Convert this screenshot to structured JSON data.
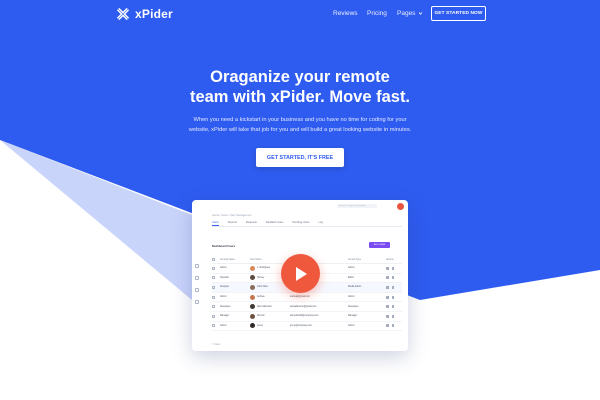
{
  "colors": {
    "primary_blue": "#2f5cf0",
    "light_blue": "#c9d4fb",
    "play_red": "#f0583e",
    "accent_purple": "#7a4cf2"
  },
  "nav": {
    "brand": "xPider",
    "links": [
      "Reviews",
      "Pricing",
      "Pages"
    ],
    "cta": "GET STARTED NOW"
  },
  "hero": {
    "headline_line1": "Oraganize your remote",
    "headline_line2": "team with xPider. Move fast.",
    "subtext_line1": "When you need a kickstart in your business and you have no time for coding for your",
    "subtext_line2": "website, xPider will take that job for you and will build a great looking website in minutes.",
    "cta": "GET STARTED, IT'S FREE"
  },
  "dashboard": {
    "breadcrumb": "Home / Users / User Management",
    "search_placeholder": "Search or type a command",
    "tabs": [
      "Users",
      "Reports",
      "Requests",
      "Disabled Users",
      "Pending Users",
      "Log"
    ],
    "section_title": "Dashboard Users",
    "add_button": "ADD USER",
    "columns": [
      "Account Name",
      "User Name",
      "Email Address",
      "Access Type",
      "Actions"
    ],
    "rows": [
      {
        "name": "Admin",
        "user": "L. Rodrigues",
        "email": "lrodrigues@gmail.com",
        "role": "Admin",
        "avatar": "#d98a5c"
      },
      {
        "name": "Operator",
        "user": "Harvey",
        "email": "harvey@company.com",
        "role": "Editor",
        "avatar": "#5b4a3f"
      },
      {
        "name": "Designer",
        "user": "John Fabe",
        "email": "johnfabe@gmail.com",
        "role": "Media Admin",
        "avatar": "#8a6b5a"
      },
      {
        "name": "Admin",
        "user": "Andrea",
        "email": "andrea@gmail.com",
        "role": "Admin",
        "avatar": "#c9764f"
      },
      {
        "name": "Developer",
        "user": "Sam Adamson",
        "email": "samadamson@gmail.com",
        "role": "Developer",
        "avatar": "#3f3a36"
      },
      {
        "name": "Manager",
        "user": "Ahmed",
        "email": "ahmedshah@company.com",
        "role": "Manager",
        "avatar": "#6e5140"
      },
      {
        "name": "Admin",
        "user": "Jenny",
        "email": "jenny@company.com",
        "role": "Admin",
        "avatar": "#2f2a28"
      }
    ],
    "footer": "7 Users"
  }
}
